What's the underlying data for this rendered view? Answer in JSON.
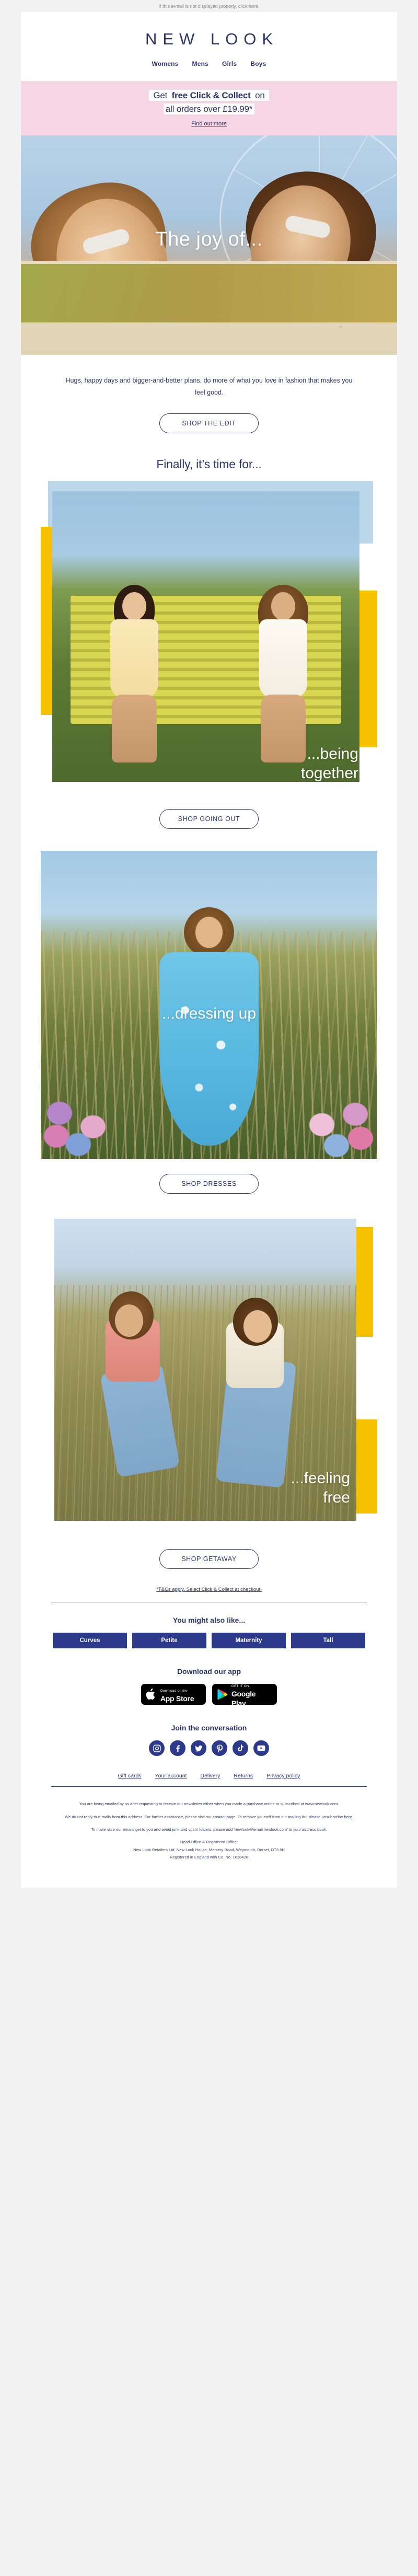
{
  "preheader": "If this e-mail is not displayed properly, click here.",
  "brand": {
    "logo": "NEW LOOK"
  },
  "nav": [
    {
      "label": "Womens"
    },
    {
      "label": "Mens"
    },
    {
      "label": "Girls"
    },
    {
      "label": "Boys"
    }
  ],
  "promo": {
    "line1_a": "Get ",
    "line1_b": "free Click & Collect",
    "line1_c": " on",
    "line2": "all orders over £19.99*",
    "link": "Find out more",
    "bg": "#f6d6e4"
  },
  "hero1": {
    "headline": "The joy of..."
  },
  "intro": {
    "body": "Hugs, happy days and bigger-and-better plans, do more of what you love in fashion that makes you feel good.",
    "cta": "SHOP THE EDIT"
  },
  "section_title": "Finally, it’s time for...",
  "hero2": {
    "line1": "...being",
    "line2": "together",
    "cta": "SHOP GOING OUT"
  },
  "hero3": {
    "headline": "...dressing up",
    "cta": "SHOP DRESSES"
  },
  "hero4": {
    "line1": "...feeling",
    "line2": "free",
    "cta": "SHOP GETAWAY"
  },
  "tcs": "*T&Cs apply. Select Click & Collect at checkout.",
  "also_like": {
    "title": "You might also like...",
    "categories": [
      {
        "label": "Curves"
      },
      {
        "label": "Petite"
      },
      {
        "label": "Maternity"
      },
      {
        "label": "Tall"
      }
    ],
    "button_color": "#2d3a8c"
  },
  "app": {
    "title": "Download our app",
    "apple": {
      "small": "Download on the",
      "big": "App Store"
    },
    "google": {
      "small": "GET IT ON",
      "big": "Google Play"
    }
  },
  "social": {
    "title": "Join the conversation",
    "icons": [
      {
        "name": "instagram"
      },
      {
        "name": "facebook"
      },
      {
        "name": "twitter"
      },
      {
        "name": "pinterest"
      },
      {
        "name": "tiktok"
      },
      {
        "name": "youtube"
      }
    ]
  },
  "footer_links": [
    {
      "label": "Gift cards"
    },
    {
      "label": "Your account"
    },
    {
      "label": "Delivery"
    },
    {
      "label": "Returns"
    },
    {
      "label": "Privacy policy"
    }
  ],
  "legal": {
    "p1": "You are being emailed by us after requesting to receive our newsletter either when you made a purchase online or subscribed at www.newlook.com.",
    "p2_a": "We do not reply to e-mails from this address. For further assistance, please visit our contact page. To remove yourself from our mailing list, please unsubscribe ",
    "p2_link": "here",
    "p2_b": ".",
    "p3": "To make sure our emails get to you and avoid junk and spam folders, please add ‘newlook@email.newlook.com’ to your address book.",
    "p4": "Head Office & Registered Office:",
    "p5": "New Look Retailers Ltd, New Look House, Mercery Road, Weymouth, Dorset, DT3 5H",
    "p6": "Registered in England with Co. No. 1618428"
  },
  "theme": {
    "navy": "#2d3669",
    "yellow": "#f6c200",
    "pink": "#f6d6e4"
  }
}
